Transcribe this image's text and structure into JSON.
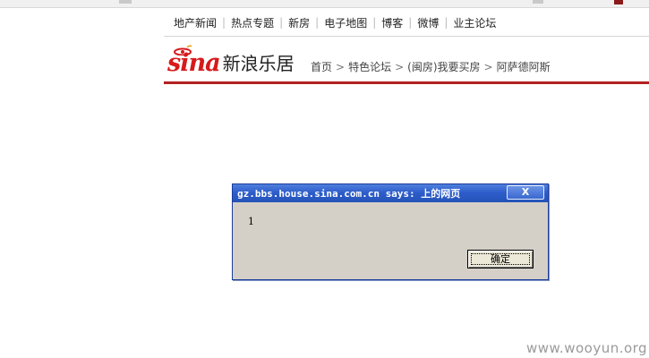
{
  "nav": {
    "items": [
      "地产新闻",
      "热点专题",
      "新房",
      "电子地图",
      "博客",
      "微博",
      "业主论坛"
    ]
  },
  "logo": {
    "word": "sina",
    "brand": "新浪乐居",
    "accent": "#d71a1b"
  },
  "breadcrumb": {
    "items": [
      "首页",
      "特色论坛",
      "(闽房)我要买房",
      "阿萨德阿斯"
    ],
    "separator": ">"
  },
  "dialog": {
    "title": "gz.bbs.house.sina.com.cn says: 上的网页",
    "close_label": "X",
    "message": "1",
    "ok_label": "确定",
    "title_color": "#2e5ecb",
    "body_color": "#d4d0c8"
  },
  "watermark": "www.wooyun.org",
  "colors": {
    "rule": "#b22222"
  }
}
